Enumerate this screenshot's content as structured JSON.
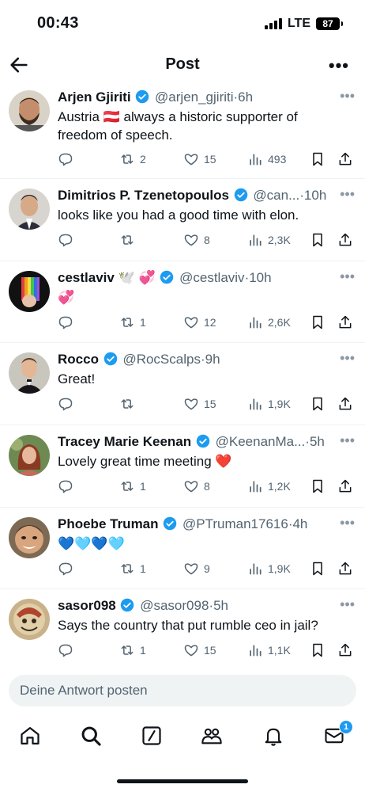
{
  "status_bar": {
    "time": "00:43",
    "network": "LTE",
    "battery": "87"
  },
  "nav": {
    "title": "Post",
    "more": "•••"
  },
  "posts": [
    {
      "name": "Arjen Gjiriti",
      "handle": "@arjen_gjiriti",
      "time": "·6h",
      "text_before": "Austria ",
      "flag": "🇦🇹",
      "text_after": " always a historic supporter of freedom of speech.",
      "replies": "",
      "reposts": "2",
      "likes": "15",
      "views": "493"
    },
    {
      "name": "Dimitrios P. Tzenetopoulos",
      "handle": "@can...",
      "time": "·10h",
      "text": "looks like you had a good time with elon.",
      "replies": "",
      "reposts": "",
      "likes": "8",
      "views": "2,3K"
    },
    {
      "name": "cestlaviv",
      "name_emoji": "🕊️ 💞",
      "handle": "@cestlaviv",
      "time": "·10h",
      "text": "💞",
      "replies": "",
      "reposts": "1",
      "likes": "12",
      "views": "2,6K"
    },
    {
      "name": "Rocco",
      "handle": "@RocScalps",
      "time": "·9h",
      "text": "Great!",
      "replies": "",
      "reposts": "",
      "likes": "15",
      "views": "1,9K"
    },
    {
      "name": "Tracey Marie Keenan",
      "handle": "@KeenanMa...",
      "time": "·5h",
      "text": "Lovely great time meeting ❤️",
      "replies": "",
      "reposts": "1",
      "likes": "8",
      "views": "1,2K"
    },
    {
      "name": "Phoebe Truman",
      "handle": "@PTruman17616",
      "time": "·4h",
      "text": "💙🩵💙🩵",
      "replies": "",
      "reposts": "1",
      "likes": "9",
      "views": "1,9K"
    },
    {
      "name": "sasor098",
      "handle": "@sasor098",
      "time": "·5h",
      "text": "Says the country that put rumble ceo in jail?",
      "replies": "",
      "reposts": "1",
      "likes": "15",
      "views": "1,1K"
    }
  ],
  "reply_bar": {
    "placeholder": "Deine Antwort posten"
  },
  "tabbar": {
    "messages_badge": "1"
  },
  "colors": {
    "accent": "#1d9bf0",
    "secondary_text": "#536471",
    "divider": "#eff3f4"
  }
}
